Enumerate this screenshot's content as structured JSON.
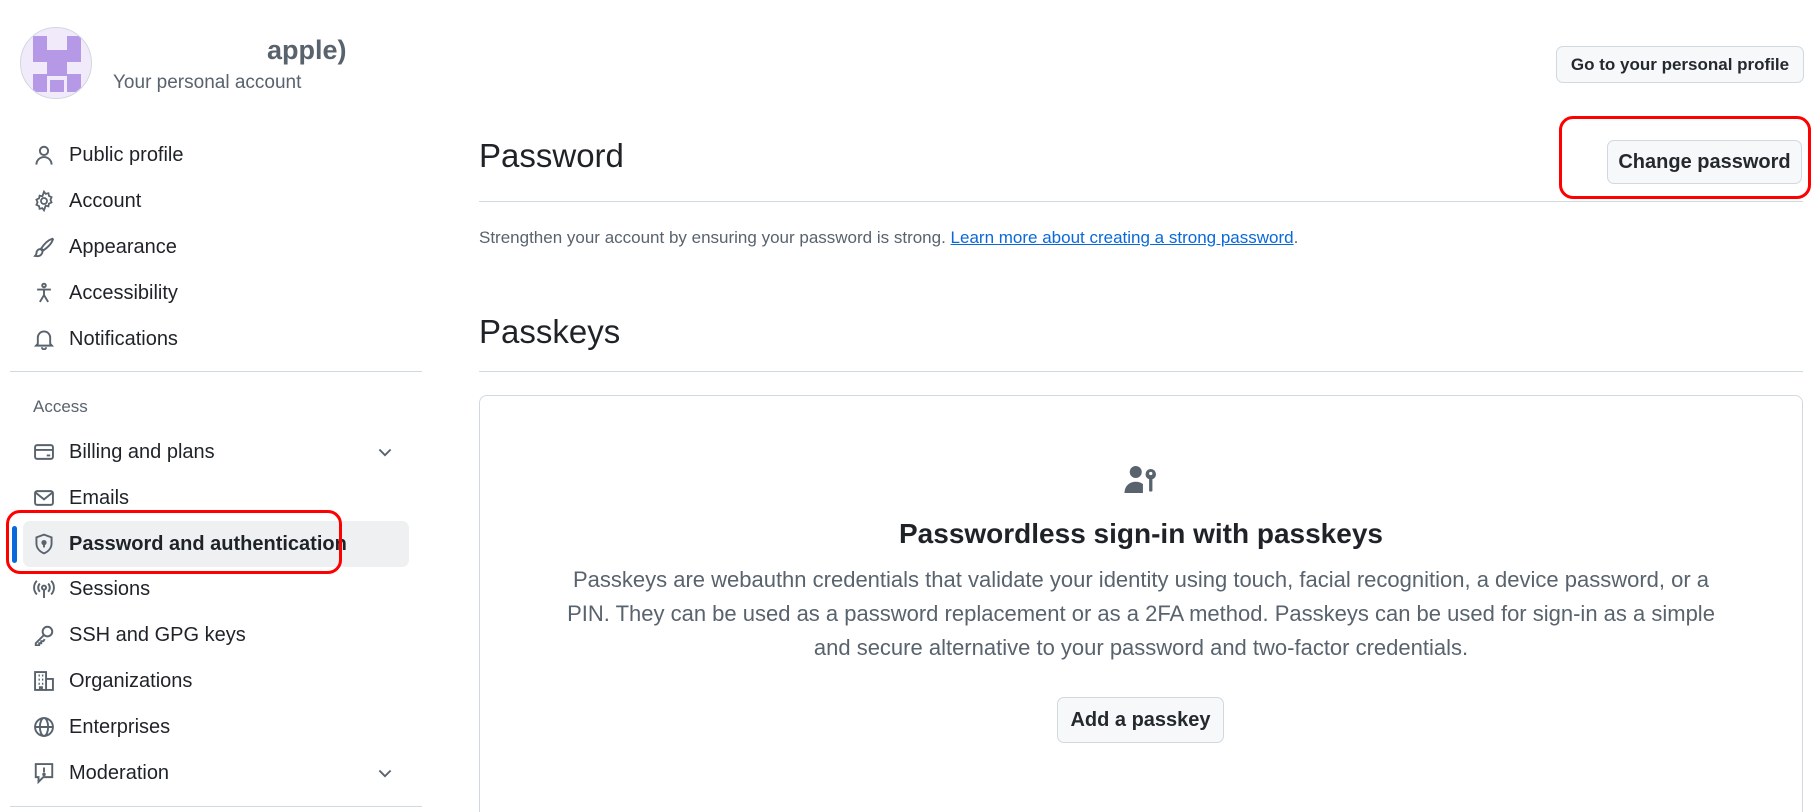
{
  "account": {
    "name": "apple)",
    "subtitle": "Your personal account",
    "profile_button": "Go to your personal profile"
  },
  "sidebar": {
    "items": [
      {
        "label": "Public profile",
        "icon": "person-icon"
      },
      {
        "label": "Account",
        "icon": "gear-icon"
      },
      {
        "label": "Appearance",
        "icon": "paintbrush-icon"
      },
      {
        "label": "Accessibility",
        "icon": "accessibility-icon"
      },
      {
        "label": "Notifications",
        "icon": "bell-icon"
      }
    ],
    "access_label": "Access",
    "access_items": [
      {
        "label": "Billing and plans",
        "icon": "credit-card-icon",
        "expandable": true
      },
      {
        "label": "Emails",
        "icon": "mail-icon"
      },
      {
        "label": "Password and authentication",
        "icon": "shield-lock-icon",
        "active": true
      },
      {
        "label": "Sessions",
        "icon": "broadcast-icon"
      },
      {
        "label": "SSH and GPG keys",
        "icon": "key-icon"
      },
      {
        "label": "Organizations",
        "icon": "organization-icon"
      },
      {
        "label": "Enterprises",
        "icon": "globe-icon"
      },
      {
        "label": "Moderation",
        "icon": "report-icon",
        "expandable": true
      }
    ]
  },
  "password": {
    "title": "Password",
    "change_button": "Change password",
    "description": "Strengthen your account by ensuring your password is strong.",
    "link_text": "Learn more about creating a strong password",
    "period": "."
  },
  "passkeys": {
    "title": "Passkeys",
    "empty_icon": "passkey-icon",
    "heading": "Passwordless sign-in with passkeys",
    "description": "Passkeys are webauthn credentials that validate your identity using touch, facial recognition, a device password, or a PIN. They can be used as a password replacement or as a 2FA method. Passkeys can be used for sign-in as a simple and secure alternative to your password and two-factor credentials.",
    "add_button": "Add a passkey"
  },
  "colors": {
    "accent": "#0969da",
    "highlight": "#ff0000",
    "muted_text": "#59636e",
    "active_bg": "#eef0f2"
  }
}
